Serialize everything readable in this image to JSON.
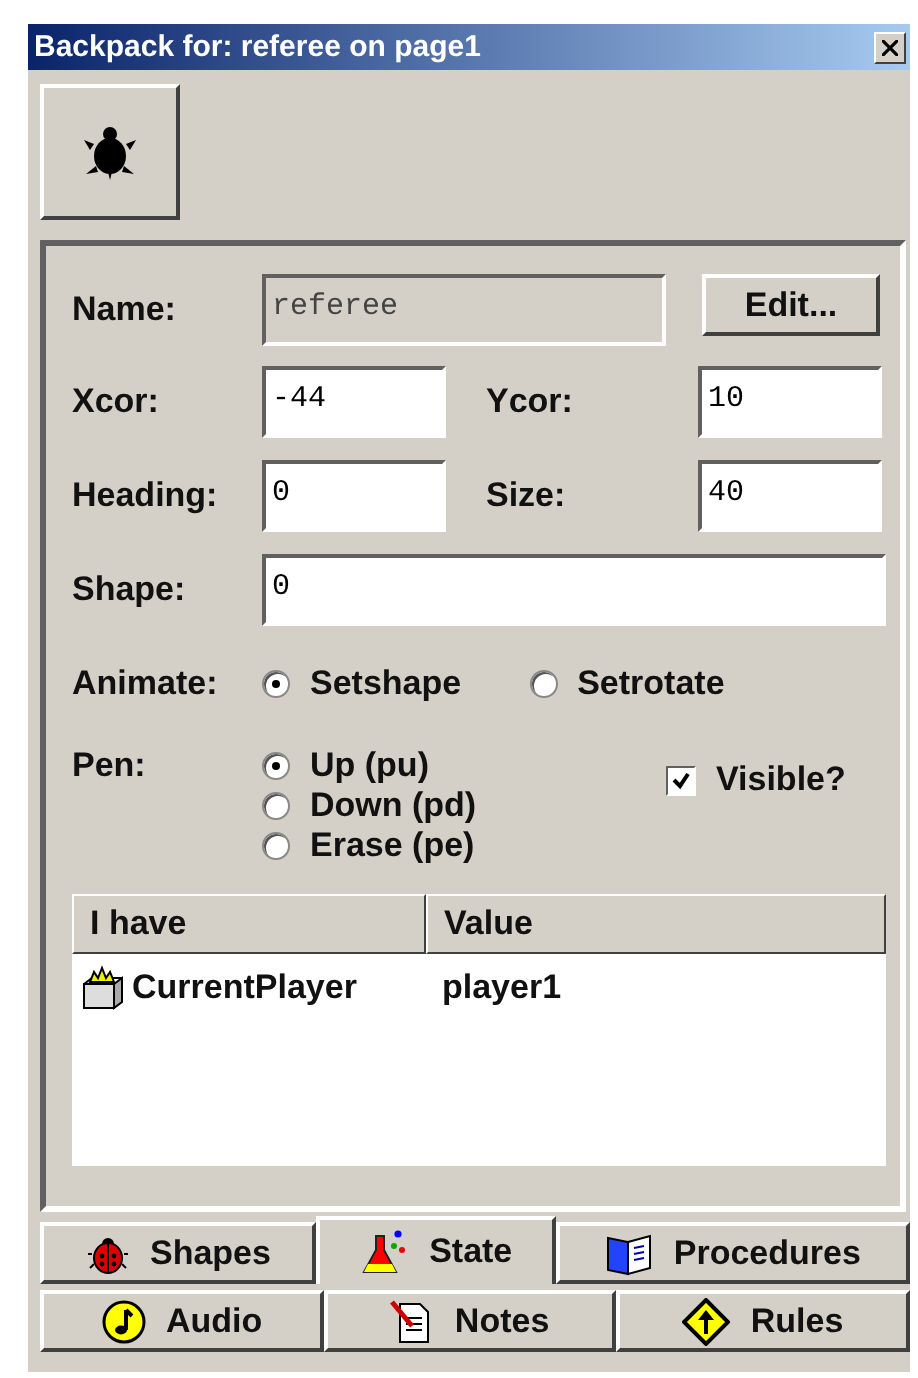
{
  "window": {
    "title": "Backpack for: referee on page1"
  },
  "name_field": {
    "label": "Name:",
    "value": "referee",
    "disabled": true
  },
  "edit_button": "Edit...",
  "coords": [
    {
      "label": "Xcor:",
      "value": "-44"
    },
    {
      "label": "Ycor:",
      "value": "10"
    },
    {
      "label": "Heading:",
      "value": "0"
    },
    {
      "label": "Size:",
      "value": "40"
    }
  ],
  "shape_field": {
    "label": "Shape:",
    "value": "0"
  },
  "animate": {
    "label": "Animate:",
    "options": [
      {
        "label": "Setshape",
        "selected": true
      },
      {
        "label": "Setrotate",
        "selected": false
      }
    ]
  },
  "pen": {
    "label": "Pen:",
    "options": [
      {
        "label": "Up (pu)",
        "selected": true
      },
      {
        "label": "Down (pd)",
        "selected": false
      },
      {
        "label": "Erase (pe)",
        "selected": false
      }
    ]
  },
  "visible": {
    "label": "Visible?",
    "checked": true
  },
  "table": {
    "columns": [
      "I have",
      "Value"
    ],
    "rows": [
      {
        "name": "CurrentPlayer",
        "value": "player1"
      }
    ]
  },
  "tabs": [
    [
      {
        "label": "Shapes",
        "selected": false
      },
      {
        "label": "State",
        "selected": true
      },
      {
        "label": "Procedures",
        "selected": false
      }
    ],
    [
      {
        "label": "Audio",
        "selected": false
      },
      {
        "label": "Notes",
        "selected": false
      },
      {
        "label": "Rules",
        "selected": false
      }
    ]
  ]
}
